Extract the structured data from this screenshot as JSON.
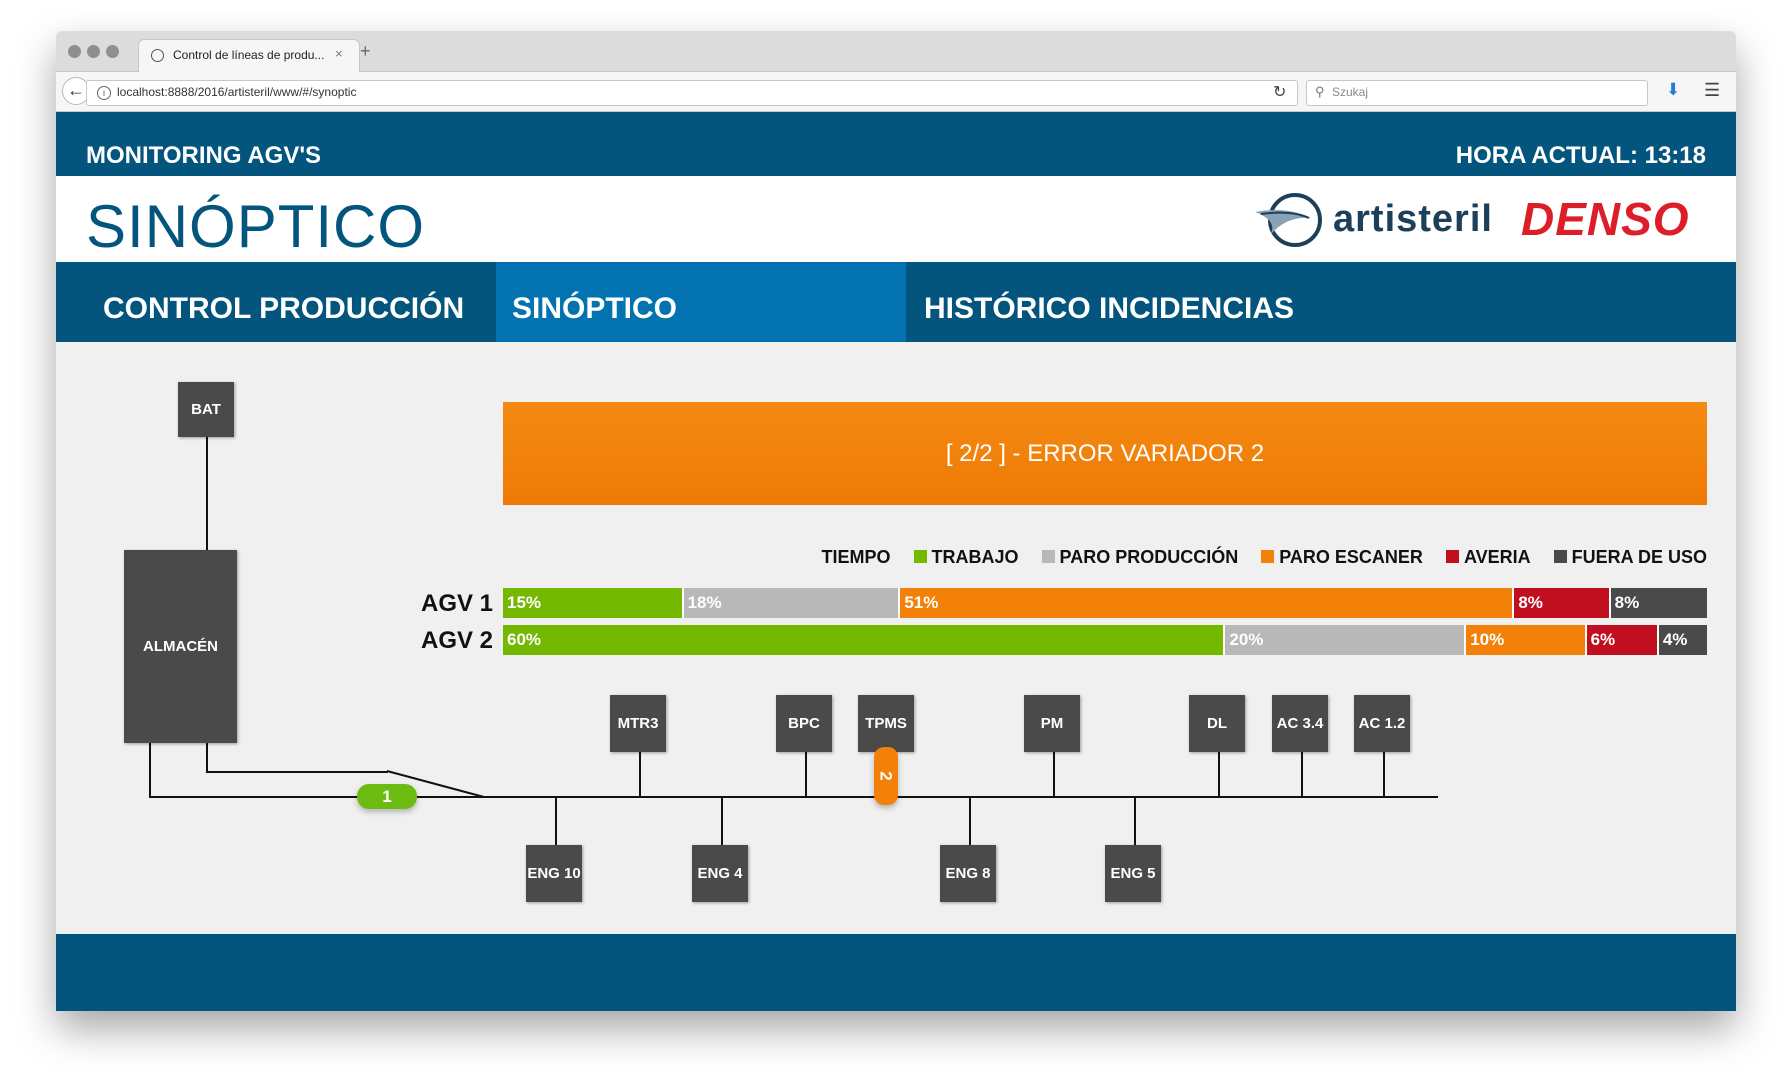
{
  "browser": {
    "tab_title": "Control de líneas de produ...",
    "tab_close": "×",
    "new_tab": "+",
    "url": "localhost:8888/2016/artisteril/www/#/synoptic",
    "search_placeholder": "Szukaj"
  },
  "app": {
    "title": "MONITORING AGV'S",
    "clock": "HORA ACTUAL: 13:18",
    "page_title": "SINÓPTICO",
    "logos": {
      "artisteril": "artisteril",
      "denso": "DENSO"
    },
    "tabs": [
      {
        "label": "CONTROL PRODUCCIÓN",
        "active": false
      },
      {
        "label": "SINÓPTICO",
        "active": true
      },
      {
        "label": "HISTÓRICO INCIDENCIAS",
        "active": false
      }
    ]
  },
  "alert": {
    "text": "[ 2/2 ] - ERROR VARIADOR 2"
  },
  "legend": {
    "title": "TIEMPO",
    "items": [
      {
        "label": "TRABAJO",
        "color": "#74b800"
      },
      {
        "label": "PARO PRODUCCIÓN",
        "color": "#b8b8b8"
      },
      {
        "label": "PARO ESCANER",
        "color": "#f28009"
      },
      {
        "label": "AVERIA",
        "color": "#c20f20"
      },
      {
        "label": "FUERA DE USO",
        "color": "#4a4a4a"
      }
    ]
  },
  "agvs": [
    {
      "label": "AGV 1",
      "segments": [
        {
          "value": 15,
          "text": "15%",
          "color": "#74b800"
        },
        {
          "value": 18,
          "text": "18%",
          "color": "#b8b8b8"
        },
        {
          "value": 51,
          "text": "51%",
          "color": "#f28009"
        },
        {
          "value": 8,
          "text": "8%",
          "color": "#c20f20"
        },
        {
          "value": 8,
          "text": "8%",
          "color": "#4a4a4a"
        }
      ]
    },
    {
      "label": "AGV 2",
      "segments": [
        {
          "value": 60,
          "text": "60%",
          "color": "#74b800"
        },
        {
          "value": 20,
          "text": "20%",
          "color": "#b8b8b8"
        },
        {
          "value": 10,
          "text": "10%",
          "color": "#f28009"
        },
        {
          "value": 6,
          "text": "6%",
          "color": "#c20f20"
        },
        {
          "value": 4,
          "text": "4%",
          "color": "#4a4a4a"
        }
      ]
    }
  ],
  "stations": {
    "bat": "BAT",
    "almacen": "ALMACÉN",
    "top": [
      "MTR3",
      "BPC",
      "TPMS",
      "PM",
      "DL",
      "AC 3.4",
      "AC 1.2"
    ],
    "bottom": [
      "ENG 10",
      "ENG 4",
      "ENG 8",
      "ENG 5"
    ]
  },
  "vehicles": {
    "agv1": "1",
    "agv2": "2"
  }
}
